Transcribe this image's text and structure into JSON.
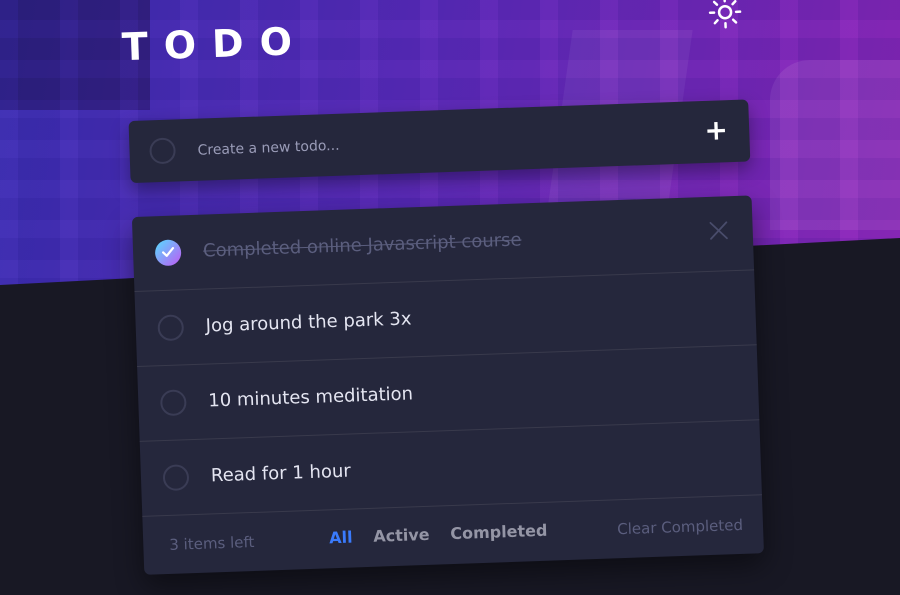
{
  "header": {
    "title": "TODO",
    "theme_toggle_icon": "sun-icon"
  },
  "new_todo": {
    "placeholder": "Create a new todo...",
    "add_label": "+"
  },
  "todos": [
    {
      "text": "Completed online Javascript course",
      "completed": true
    },
    {
      "text": "Jog around the park 3x",
      "completed": false
    },
    {
      "text": "10 minutes meditation",
      "completed": false
    },
    {
      "text": "Read for 1 hour",
      "completed": false
    }
  ],
  "footer": {
    "items_left": "3 items left",
    "filters": [
      "All",
      "Active",
      "Completed"
    ],
    "active_filter": "All",
    "clear_label": "Clear Completed"
  },
  "colors": {
    "accent": "#3a7bfd",
    "card": "#25273c",
    "page_background": "#181824",
    "check_gradient_start": "#55ddff",
    "check_gradient_end": "#c058f3"
  }
}
